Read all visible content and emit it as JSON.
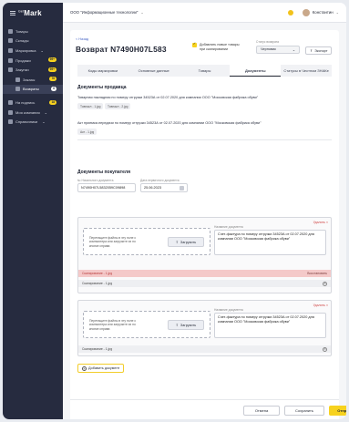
{
  "logo": {
    "text": "Mark",
    "sup": "Get"
  },
  "sidebar": {
    "items": [
      {
        "label": "Товары"
      },
      {
        "label": "Склады"
      },
      {
        "label": "Маркировка",
        "chevron": "⌄"
      },
      {
        "label": "Продажи",
        "badge": "99+"
      },
      {
        "label": "Закупки",
        "badge": "99+"
      },
      {
        "label": "Заказы",
        "badge": "76"
      },
      {
        "label": "Возвраты",
        "badge": "6"
      },
      {
        "label": "На подпись",
        "badge": "18"
      },
      {
        "label": "Моя компания",
        "chevron": "⌄"
      },
      {
        "label": "Справочники",
        "chevron": "⌄"
      }
    ]
  },
  "topbar": {
    "org": "ООО \"Информационные технологии\"",
    "chev": "⌄",
    "user": "Константин",
    "user_chev": "⌄"
  },
  "page": {
    "back": "< Назад",
    "title": "Возврат N7490H07L583",
    "checkbox_label_1": "Добавлять новые товары",
    "checkbox_label_2": "при сканировании",
    "status_label": "Статус возврата",
    "status_value": "Черновик",
    "status_chev": "⌄",
    "export": "Экспорт",
    "export_icon": "⇪"
  },
  "tabs": [
    "Коды маркировки",
    "Основные данные",
    "Товары",
    "Документы",
    "Статусы в Честном ЗНАКе"
  ],
  "seller_docs": {
    "title": "Документы продавца",
    "doc1": "Товарная накладная по номеру отгрузки 34523А от 02.07.2020 для компании ООО \"Московская фабрика обуви\"",
    "doc1_chip": "Товнакл - 1.jpg",
    "doc1_chip2": "Товнакл - 2.jpg",
    "doc2": "Акт приемки-передачи по номеру отгрузки 34523А от 02.07.2020 для компании ООО \"Московская фабрика обуви\"",
    "doc2_chip": "Акт - 1.jpg"
  },
  "buyer_docs": {
    "title": "Документы покупателя",
    "num_label": "№ Начального документа",
    "num_value": "N7490H07L5832059C09898",
    "date_label": "Дата первичного документа",
    "date_value": "25.06.2023"
  },
  "blocks": [
    {
      "delete": "Удалить ×",
      "drop_text": "Перетащите файлы в эту поле с компьютера или загрузите их по кнопке справа",
      "upload": "Загрузить",
      "upload_icon": "⇧",
      "name_label": "Название документа",
      "name_value": "Счет-фактура по номеру отгрузки 34523А от 02.07.2020 для компании ООО \"Московская фабрика обуви\"",
      "err_file": "Сканирование - 1.jpg",
      "restore": "Восстановить",
      "file": "Сканирование - 1.jpg"
    },
    {
      "delete": "Удалить ×",
      "drop_text": "Перетащите файлы в эту поле с компьютера или загрузите их по кнопке справа",
      "upload": "Загрузить",
      "upload_icon": "⇧",
      "name_label": "Название документа",
      "name_value": "Счет-фактура по номеру отгрузки 34523А от 02.07.2020 для компании ООО \"Московская фабрика обуви\"",
      "file": "Сканирование - 1.jpg"
    }
  ],
  "add_doc": "Добавить документ",
  "footer": {
    "cancel": "Отмена",
    "save": "Сохранить",
    "send": "Отправить в Честный ЗНАК"
  }
}
